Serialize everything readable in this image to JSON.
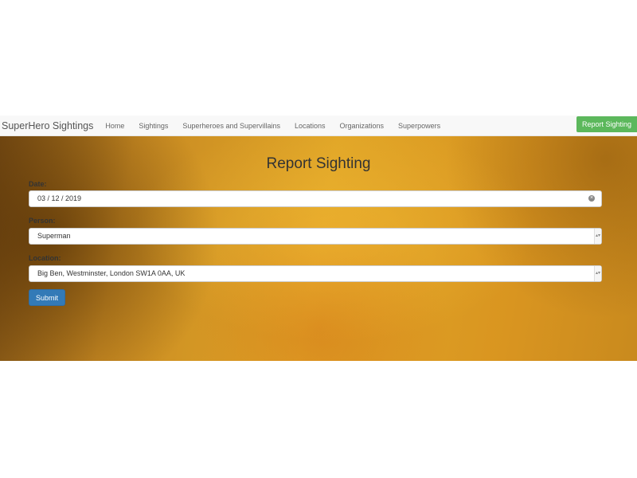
{
  "navbar": {
    "brand": "SuperHero Sightings",
    "links": [
      "Home",
      "Sightings",
      "Superheroes and Supervillains",
      "Locations",
      "Organizations",
      "Superpowers"
    ],
    "report_button": "Report Sighting"
  },
  "form": {
    "title": "Report Sighting",
    "date_label": "Date:",
    "date_value": "03 / 12 / 2019",
    "person_label": "Person:",
    "person_value": "Superman",
    "location_label": "Location:",
    "location_value": "Big Ben, Westminster, London SW1A 0AA, UK",
    "submit_label": "Submit"
  },
  "colors": {
    "accent_green": "#5cb85c",
    "primary_blue": "#337ab7",
    "background_gold": "#e0a527"
  },
  "icons": {
    "date_clear": "clear-icon",
    "select_arrow": "chevron-down-icon"
  }
}
